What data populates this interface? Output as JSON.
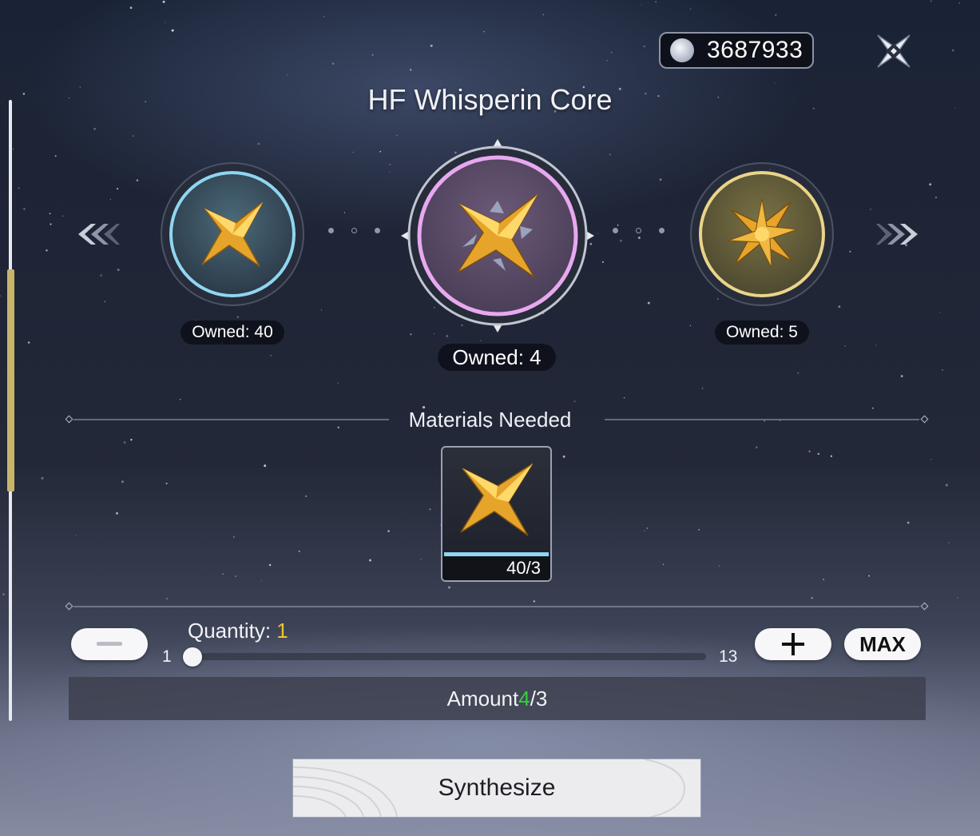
{
  "currency": {
    "icon": "silver-coin-icon",
    "amount": "3687933"
  },
  "close": {
    "icon": "close-x-icon"
  },
  "title": "HF Whisperin Core",
  "carousel": {
    "prev_icon": "double-chevron-left-icon",
    "next_icon": "double-chevron-right-icon",
    "items": [
      {
        "name": "core-tier-left",
        "ring_color": "#8fd6ef",
        "owned": "Owned: 40"
      },
      {
        "name": "core-tier-center",
        "ring_color": "#e8a8ef",
        "owned": "Owned: 4"
      },
      {
        "name": "core-tier-right",
        "ring_color": "#ead48a",
        "owned": "Owned: 5"
      }
    ]
  },
  "materials": {
    "heading": "Materials Needed",
    "items": [
      {
        "icon": "star-core-icon",
        "count": "40/3"
      }
    ]
  },
  "quantity": {
    "label": "Quantity: ",
    "value": "1",
    "min": "1",
    "max": "13",
    "level": 0,
    "minus_icon": "minus-icon",
    "plus_icon": "plus-icon",
    "max_label": "MAX"
  },
  "amount": {
    "label": "Amount ",
    "current": "4",
    "required": "/3"
  },
  "synthesize_label": "Synthesize",
  "colors": {
    "accent_gold": "#f2c230",
    "accent_green": "#35d23a",
    "bar_blue": "#8fd6ef"
  }
}
